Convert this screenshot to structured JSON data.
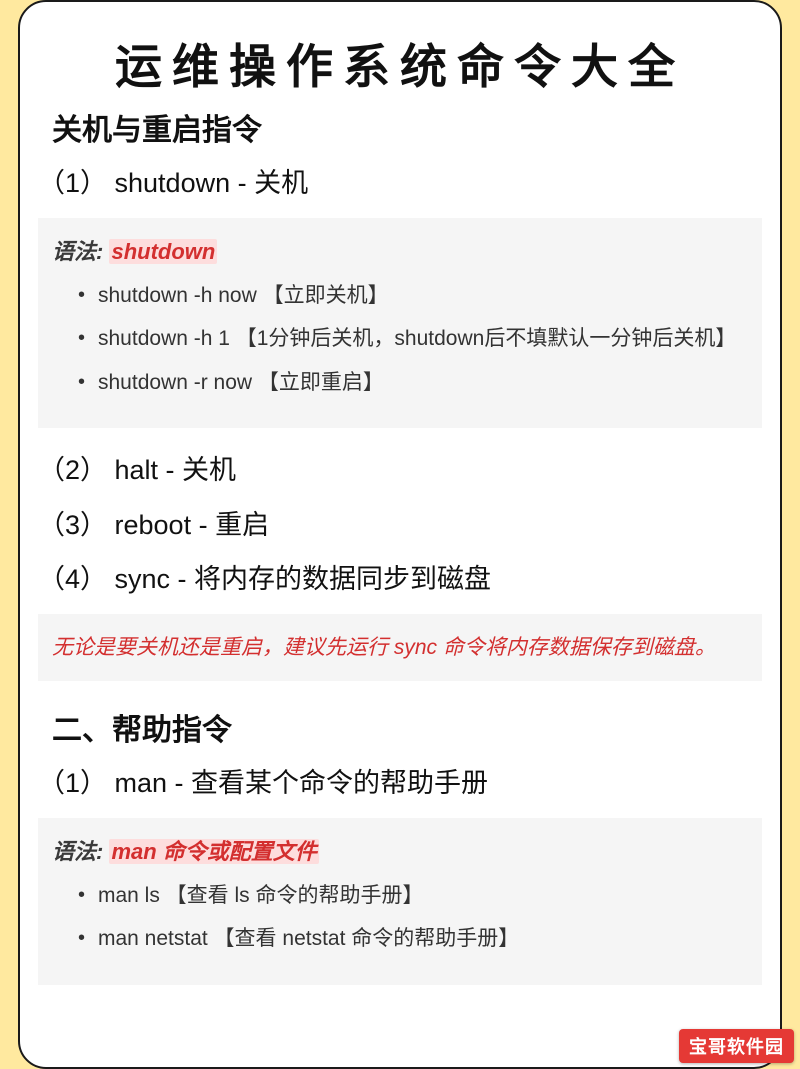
{
  "title": "运维操作系统命令大全",
  "section1": {
    "heading": "关机与重启指令",
    "items": {
      "i1": "（1） shutdown - 关机",
      "i2": "（2） halt - 关机",
      "i3": "（3） reboot - 重启",
      "i4": "（4） sync - 将内存的数据同步到磁盘"
    },
    "syntax": {
      "label": "语法: ",
      "cmd": "shutdown",
      "bullets": {
        "b1": "shutdown -h now 【立即关机】",
        "b2": "shutdown -h 1 【1分钟后关机，shutdown后不填默认一分钟后关机】",
        "b3": "shutdown -r now 【立即重启】"
      }
    },
    "note": "无论是要关机还是重启，建议先运行 sync 命令将内存数据保存到磁盘。"
  },
  "section2": {
    "heading": "二、帮助指令",
    "items": {
      "i1": "（1） man - 查看某个命令的帮助手册"
    },
    "syntax": {
      "label": "语法: ",
      "cmd": "man 命令或配置文件",
      "bullets": {
        "b1": "man ls 【查看 ls 命令的帮助手册】",
        "b2": "man netstat 【查看 netstat 命令的帮助手册】"
      }
    }
  },
  "watermark": "宝哥软件园"
}
